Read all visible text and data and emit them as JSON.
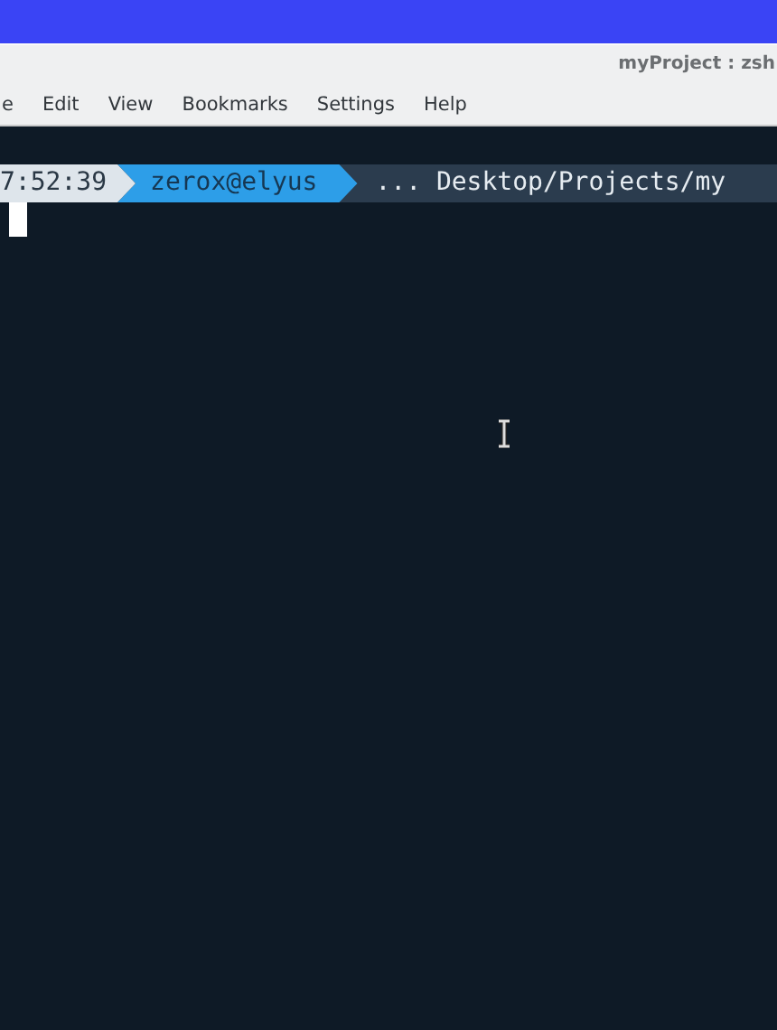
{
  "window": {
    "title": "myProject : zsh"
  },
  "menu": [
    {
      "label": "e"
    },
    {
      "label": "Edit"
    },
    {
      "label": "View"
    },
    {
      "label": "Bookmarks"
    },
    {
      "label": "Settings"
    },
    {
      "label": "Help"
    }
  ],
  "prompt": {
    "time": "7:52:39",
    "user_host": "zerox@elyus",
    "path": "... Desktop/Projects/my"
  }
}
